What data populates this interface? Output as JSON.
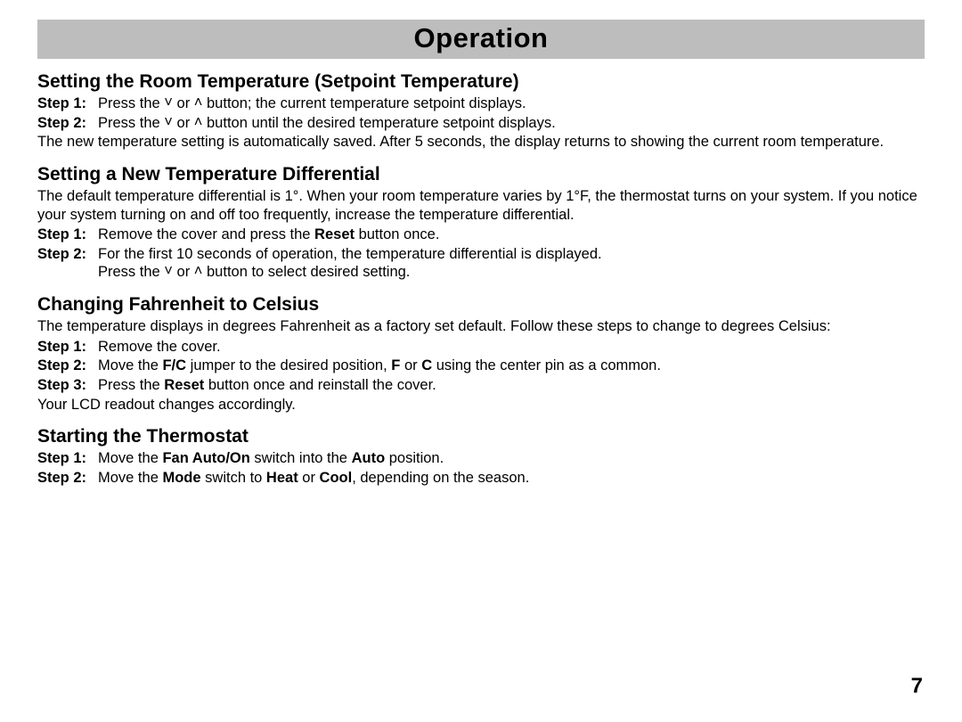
{
  "title": "Operation",
  "page_number": "7",
  "glyphs": {
    "down": "˅",
    "up": "˄"
  },
  "sections": [
    {
      "heading": "Setting the Room Temperature (Setpoint Temperature)",
      "intro": "",
      "steps": [
        {
          "label": "Step 1:",
          "parts": [
            "Press the ",
            {
              "g": "down"
            },
            " or ",
            {
              "g": "up"
            },
            " button; the current temperature setpoint displays."
          ]
        },
        {
          "label": "Step 2:",
          "parts": [
            "Press the ",
            {
              "g": "down"
            },
            " or ",
            {
              "g": "up"
            },
            " button until the desired temperature setpoint displays."
          ]
        }
      ],
      "outro": "The new temperature setting is automatically saved. After 5 seconds, the display returns to showing the current room temperature."
    },
    {
      "heading": "Setting a New Temperature Differential",
      "intro": "The default temperature differential is 1°. When your room temperature varies by 1°F, the thermostat turns on your system. If you notice your system turning on and off too frequently, increase the temperature differential.",
      "steps": [
        {
          "label": "Step 1:",
          "parts": [
            "Remove the cover and press the ",
            {
              "b": "Reset"
            },
            " button once."
          ]
        },
        {
          "label": "Step 2:",
          "parts": [
            "For the first 10 seconds of operation, the temperature differential is displayed.",
            {
              "br": true
            },
            "Press the ",
            {
              "g": "down"
            },
            " or ",
            {
              "g": "up"
            },
            " button to select desired setting."
          ]
        }
      ],
      "outro": ""
    },
    {
      "heading": "Changing Fahrenheit to Celsius",
      "intro": "The temperature displays in degrees Fahrenheit as a factory set default. Follow these steps to change to degrees Celsius:",
      "steps": [
        {
          "label": "Step 1:",
          "parts": [
            "Remove the cover."
          ]
        },
        {
          "label": "Step 2:",
          "parts": [
            "Move the ",
            {
              "b": "F/C"
            },
            " jumper to the desired position, ",
            {
              "b": "F"
            },
            " or ",
            {
              "b": "C"
            },
            " using the center pin as a common."
          ]
        },
        {
          "label": "Step 3:",
          "parts": [
            "Press the ",
            {
              "b": "Reset"
            },
            " button once and reinstall the cover."
          ]
        }
      ],
      "outro": "Your LCD readout changes accordingly."
    },
    {
      "heading": "Starting the Thermostat",
      "intro": "",
      "steps": [
        {
          "label": "Step 1:",
          "parts": [
            "Move the ",
            {
              "b": "Fan Auto/On"
            },
            " switch into the ",
            {
              "b": "Auto"
            },
            " position."
          ]
        },
        {
          "label": "Step 2:",
          "parts": [
            "Move the ",
            {
              "b": "Mode"
            },
            " switch to ",
            {
              "b": "Heat"
            },
            " or ",
            {
              "b": "Cool"
            },
            ", depending on the season."
          ]
        }
      ],
      "outro": ""
    }
  ]
}
